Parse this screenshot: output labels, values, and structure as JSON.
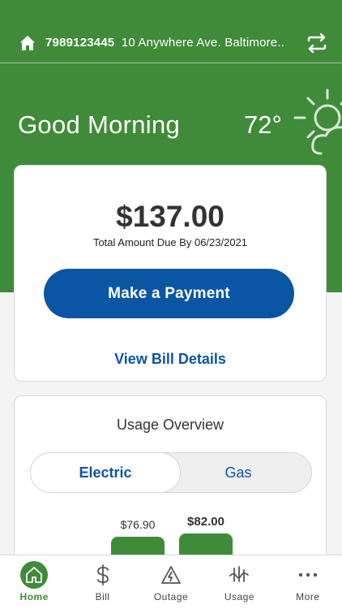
{
  "header": {
    "account_number": "7989123445",
    "address": "10 Anywhere Ave. Baltimore..",
    "greeting": "Good Morning",
    "temperature": "72°",
    "weather_icon": "partly-sunny-icon"
  },
  "bill": {
    "amount": "$137.00",
    "due_text": "Total Amount Due By 06/23/2021",
    "pay_label": "Make a Payment",
    "details_label": "View Bill Details"
  },
  "usage": {
    "title": "Usage Overview",
    "tabs": [
      "Electric",
      "Gas"
    ],
    "selected": "Electric",
    "bars": [
      {
        "label": "$76.90",
        "value": 76.9
      },
      {
        "label": "$82.00",
        "value": 82.0
      }
    ]
  },
  "nav": [
    {
      "label": "Home",
      "icon": "home-icon",
      "active": true
    },
    {
      "label": "Bill",
      "icon": "dollar-icon",
      "active": false
    },
    {
      "label": "Outage",
      "icon": "warning-icon",
      "active": false
    },
    {
      "label": "Usage",
      "icon": "usage-icon",
      "active": false
    },
    {
      "label": "More",
      "icon": "more-icon",
      "active": false
    }
  ],
  "colors": {
    "brand_green": "#3f8b3a",
    "brand_blue": "#0b55a5"
  }
}
